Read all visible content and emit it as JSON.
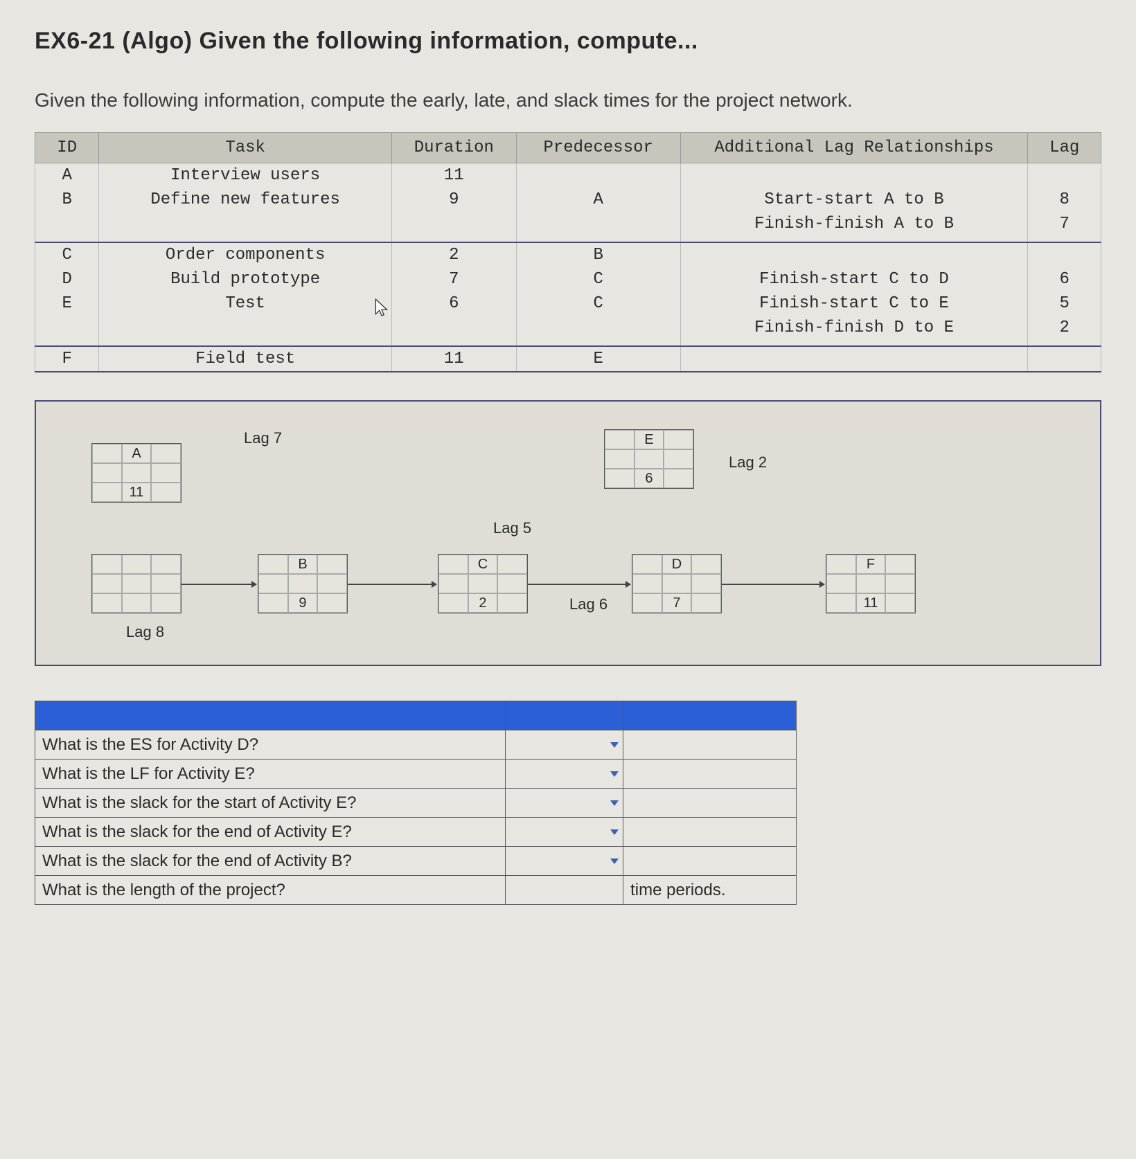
{
  "title": "EX6-21 (Algo) Given the following information, compute...",
  "intro": "Given the following information, compute the early, late, and slack times for the project network.",
  "headers": {
    "id": "ID",
    "task": "Task",
    "duration": "Duration",
    "predecessor": "Predecessor",
    "relationships": "Additional Lag Relationships",
    "lag": "Lag"
  },
  "rows": [
    {
      "id": "A",
      "task": "Interview users",
      "duration": "11",
      "pred": "",
      "rel": "",
      "lag": ""
    },
    {
      "id": "B",
      "task": "Define new features",
      "duration": "9",
      "pred": "A",
      "rel": "Start-start A to B",
      "lag": "8"
    },
    {
      "id": "",
      "task": "",
      "duration": "",
      "pred": "",
      "rel": "Finish-finish A to B",
      "lag": "7"
    },
    {
      "id": "C",
      "task": "Order components",
      "duration": "2",
      "pred": "B",
      "rel": "",
      "lag": ""
    },
    {
      "id": "D",
      "task": "Build prototype",
      "duration": "7",
      "pred": "C",
      "rel": "Finish-start C to D",
      "lag": "6"
    },
    {
      "id": "E",
      "task": "Test",
      "duration": "6",
      "pred": "C",
      "rel": "Finish-start C to E",
      "lag": "5"
    },
    {
      "id": "",
      "task": "",
      "duration": "",
      "pred": "",
      "rel": "Finish-finish D to E",
      "lag": "2"
    },
    {
      "id": "F",
      "task": "Field test",
      "duration": "11",
      "pred": "E",
      "rel": "",
      "lag": ""
    }
  ],
  "diagram": {
    "nodes": {
      "A": {
        "label": "A",
        "dur": "11"
      },
      "B": {
        "label": "B",
        "dur": "9"
      },
      "C": {
        "label": "C",
        "dur": "2"
      },
      "D": {
        "label": "D",
        "dur": "7"
      },
      "E": {
        "label": "E",
        "dur": "6"
      },
      "F": {
        "label": "F",
        "dur": "11"
      }
    },
    "lags": {
      "lag7": "Lag 7",
      "lag8": "Lag 8",
      "lag5": "Lag 5",
      "lag6": "Lag 6",
      "lag2": "Lag 2"
    }
  },
  "questions": [
    {
      "q": "What is the ES for Activity D?",
      "unit": ""
    },
    {
      "q": "What is the LF for Activity E?",
      "unit": ""
    },
    {
      "q": "What is the slack for the start of Activity E?",
      "unit": ""
    },
    {
      "q": "What is the slack for the end of Activity E?",
      "unit": ""
    },
    {
      "q": "What is the slack for the end of Activity B?",
      "unit": ""
    },
    {
      "q": "What is the length of the project?",
      "unit": "time periods."
    }
  ]
}
